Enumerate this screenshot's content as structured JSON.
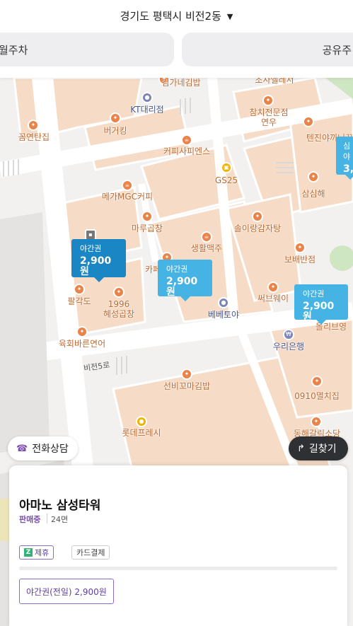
{
  "header": {
    "region": "경기도 평택시 비전2동",
    "tabs": [
      "월주차",
      "공유주"
    ]
  },
  "map": {
    "pois": [
      {
        "name": "김가네김밥",
        "kind": "food"
      },
      {
        "name": "조사엘레서",
        "kind": "food"
      },
      {
        "name": "KT대리점",
        "kind": "blue"
      },
      {
        "name": "참치전문점\n연우",
        "kind": "food"
      },
      {
        "name": "버거킹",
        "kind": "food"
      },
      {
        "name": "텐진야끼니꾸",
        "kind": "food"
      },
      {
        "name": "꼼연탄집",
        "kind": "food"
      },
      {
        "name": "커피사피엔스",
        "kind": "food"
      },
      {
        "name": "GS25",
        "kind": "yellow"
      },
      {
        "name": "삼심해",
        "kind": "food"
      },
      {
        "name": "메가MGC커피",
        "kind": "food"
      },
      {
        "name": "마루곱창",
        "kind": "food"
      },
      {
        "name": "솔이랑감자탕",
        "kind": "food"
      },
      {
        "name": "생활맥주",
        "kind": "food"
      },
      {
        "name": "보배반점",
        "kind": "food"
      },
      {
        "name": "카페",
        "kind": "food"
      },
      {
        "name": "써브웨이",
        "kind": "food"
      },
      {
        "name": "팔각도",
        "kind": "food"
      },
      {
        "name": "1996\n혜성곱창",
        "kind": "food"
      },
      {
        "name": "베베토야",
        "kind": "blue"
      },
      {
        "name": "올리브영",
        "kind": "food"
      },
      {
        "name": "우리은행",
        "kind": "blue"
      },
      {
        "name": "육회바른연어",
        "kind": "food"
      },
      {
        "name": "선비꼬마김밥",
        "kind": "food"
      },
      {
        "name": "0910멸치집",
        "kind": "food"
      },
      {
        "name": "롯데프레시",
        "kind": "yellow"
      },
      {
        "name": "동해갈릭소당",
        "kind": "food"
      }
    ],
    "road": "비전5로",
    "price_pins": [
      {
        "label": "야간권",
        "value": "2,900원",
        "style": "dark"
      },
      {
        "label": "야간권",
        "value": "2,900원",
        "style": "light"
      },
      {
        "label": "야간권",
        "value": "2,900원",
        "style": "light"
      },
      {
        "label": "심야",
        "value": "3,",
        "style": "light"
      }
    ]
  },
  "actions": {
    "phone": "전화상담",
    "route": "길찾기"
  },
  "card": {
    "title": "아마노 삼성타워",
    "status": "판매중",
    "spaces": "24면",
    "tags": {
      "partner": "제휴",
      "partner_icon": "Z",
      "payment": "카드결제"
    },
    "ticket": "야간권(전일) 2,900원"
  },
  "colors": {
    "accent": "#7b4fb0",
    "pin_dark": "#1b86c4",
    "pin_light": "#45b3e4",
    "poi_food": "#e8844a"
  }
}
